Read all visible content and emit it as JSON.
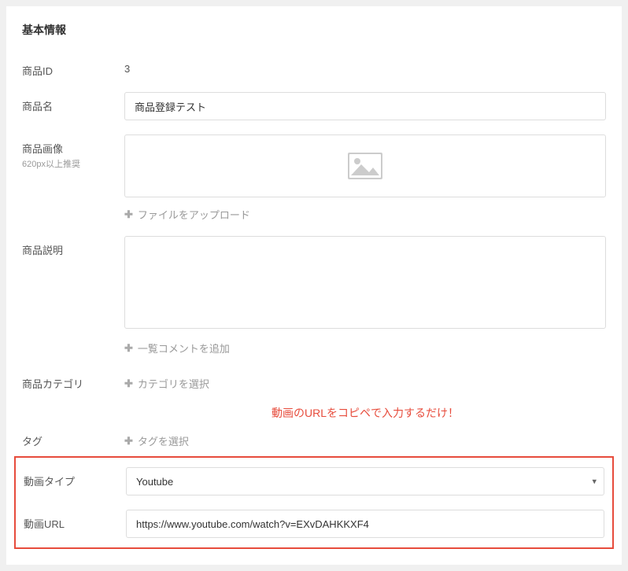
{
  "panel": {
    "title": "基本情報"
  },
  "fields": {
    "product_id": {
      "label": "商品ID",
      "value": "3"
    },
    "product_name": {
      "label": "商品名",
      "value": "商品登録テスト"
    },
    "product_image": {
      "label": "商品画像",
      "sub_label": "620px以上推奨",
      "upload_text": "ファイルをアップロード"
    },
    "product_description": {
      "label": "商品説明",
      "add_comment_text": "一覧コメントを追加"
    },
    "category": {
      "label": "商品カテゴリ",
      "action_text": "カテゴリを選択"
    },
    "tag": {
      "label": "タグ",
      "action_text": "タグを選択"
    },
    "video_type": {
      "label": "動画タイプ",
      "selected": "Youtube"
    },
    "video_url": {
      "label": "動画URL",
      "value": "https://www.youtube.com/watch?v=EXvDAHKKXF4"
    }
  },
  "annotation": {
    "text": "動画のURLをコピペで入力するだけ！"
  }
}
